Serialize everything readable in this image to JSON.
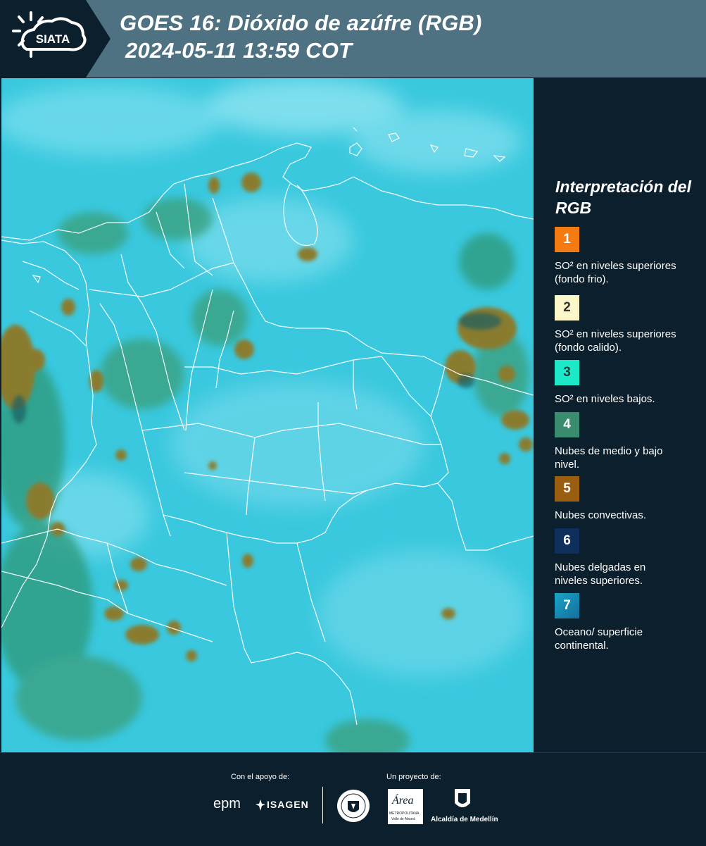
{
  "header": {
    "logo_text": "SIATA",
    "title_line1": "GOES 16: Dióxido de azúfre (RGB)",
    "title_line2": "2024-05-11 13:59 COT"
  },
  "map": {
    "description_colors": {
      "ocean_land": "#38c9e0",
      "low_clouds": "#2e9a84",
      "convective": "#8a7a2c",
      "borders": "#ffffff"
    }
  },
  "legend": {
    "title": "Interpretación del RGB",
    "items": [
      {
        "number": "1",
        "color": "#f47b12",
        "text": "SO² en niveles superiores (fondo frio)."
      },
      {
        "number": "2",
        "color": "#fbf7c8",
        "text": "SO² en niveles superiores (fondo calido)."
      },
      {
        "number": "3",
        "color": "#1de8c8",
        "text": "SO² en niveles bajos."
      },
      {
        "number": "4",
        "color": "#3a8c6e",
        "text": "Nubes de medio y bajo nivel."
      },
      {
        "number": "5",
        "color": "#9a5e10",
        "text": "Nubes convectivas."
      },
      {
        "number": "6",
        "color": "#0e2e5c",
        "text": "Nubes delgadas en niveles superiores."
      },
      {
        "number": "7",
        "color": "#1e8fb8",
        "text": "Oceano/ superficie continental."
      }
    ]
  },
  "footer": {
    "support_label": "Con el apoyo de:",
    "project_label": "Un proyecto de:",
    "logos": {
      "epm": "epm",
      "isagen": "ISAGEN",
      "area": "Área",
      "area_sub": "METROPOLITANA",
      "area_sub2": "Valle de Aburrá",
      "alcaldia": "Alcaldía de Medellín",
      "medellin": "MEDELLÍN"
    }
  }
}
